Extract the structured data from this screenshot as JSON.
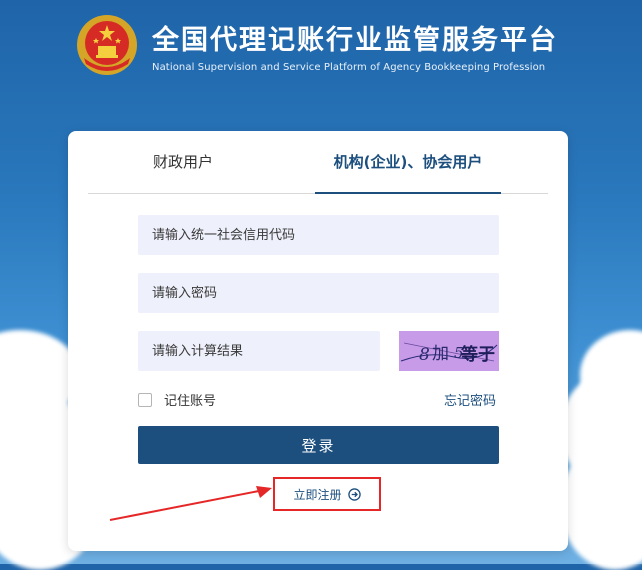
{
  "header": {
    "title": "全国代理记账行业监管服务平台",
    "subtitle": "National Supervision and Service Platform of Agency Bookkeeping  Profession"
  },
  "tabs": [
    {
      "label": "财政用户",
      "active": false
    },
    {
      "label": "机构(企业)、协会用户",
      "active": true
    }
  ],
  "form": {
    "credit_code_placeholder": "请输入统一社会信用代码",
    "password_placeholder": "请输入密码",
    "calc_placeholder": "请输入计算结果",
    "captcha_text": [
      "8",
      "加",
      "5",
      "等于"
    ],
    "remember_label": "记住账号",
    "remember_checked": false,
    "forgot_label": "忘记密码",
    "login_label": "登录",
    "register_label": "立即注册"
  },
  "colors": {
    "accent": "#1c4f7e",
    "highlight_box": "#e52727",
    "captcha_bg": "#c79be8"
  }
}
